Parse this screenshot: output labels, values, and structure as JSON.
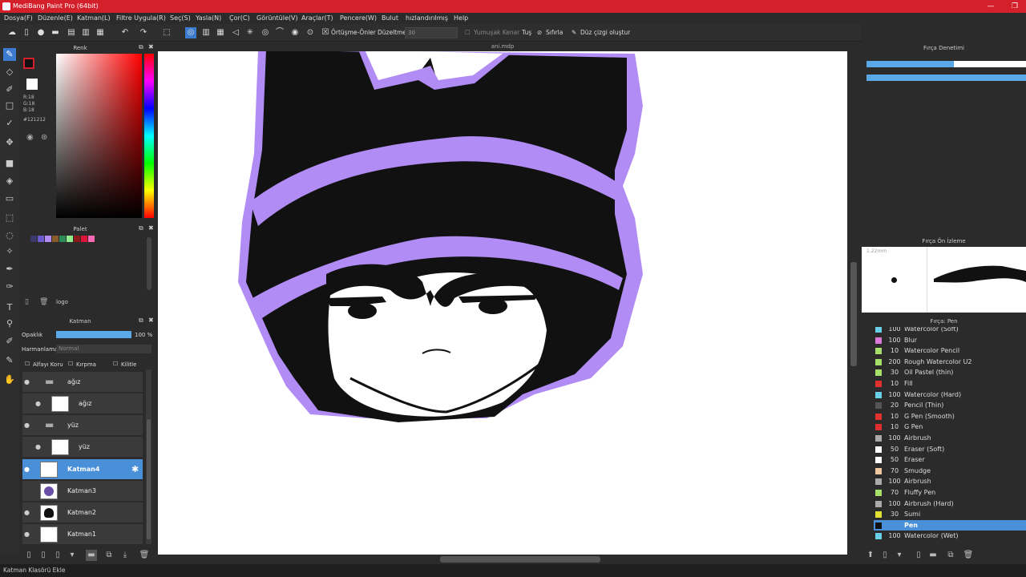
{
  "window": {
    "title": "MediBang Paint Pro (64bit)",
    "minimize": "—",
    "restore": "❐"
  },
  "menu": [
    "Dosya(F)",
    "Düzenle(E)",
    "Katman(L)",
    "Filtre Uygula(R)",
    "Seç(S)",
    "Yasla(N)",
    "Çor(C)",
    "Görüntüle(V)",
    "Araçlar(T)",
    "Pencere(W)",
    "Bulut",
    "hızlandırılmış",
    "Help"
  ],
  "toolbar": {
    "overlap_label": "Örtüşme-Önler",
    "correction_label": "Düzeltme",
    "correction_value": "30",
    "soft_edge_label": "Yumuşak Kenar",
    "tus_label": "Tuş",
    "reset_label": "Sıfırla",
    "straight_line_label": "Düz çizgi oluştur"
  },
  "canvas": {
    "filename": "ani.mdp",
    "hat_color": "#111111",
    "outline_color": "#b18cf5"
  },
  "color_panel": {
    "title": "Renk",
    "r": "R:18",
    "g": "G:18",
    "b": "B:18",
    "hex": "#121212",
    "primary": "#d4202a",
    "secondary": "#ffffff"
  },
  "palette": {
    "title": "Palet",
    "swatches": [
      "#2b2b2b",
      "#3a3a6a",
      "#6a5acd",
      "#b18cf5",
      "#8b5a2b",
      "#2e8b57",
      "#90ee90",
      "#8b1a1a",
      "#dc143c",
      "#ff69b4"
    ],
    "group_name": "logo"
  },
  "layer_panel": {
    "title": "Katman",
    "opacity_label": "Opaklık",
    "opacity_value": "100 %",
    "opacity_fraction": 1.0,
    "blend_label": "Harmanlama",
    "blend_value": "Normal",
    "alpha_lock": "Alfayı Koru",
    "clipping": "Kırpma",
    "lock": "Kilitle",
    "layers": [
      {
        "name": "ağız",
        "kind": "folder"
      },
      {
        "name": "ağız",
        "kind": "layer"
      },
      {
        "name": "yüz",
        "kind": "folder"
      },
      {
        "name": "yüz",
        "kind": "layer"
      },
      {
        "name": "Katman4",
        "kind": "layer",
        "selected": true
      },
      {
        "name": "Katman3",
        "kind": "layer"
      },
      {
        "name": "Katman2",
        "kind": "layer"
      },
      {
        "name": "Katman1",
        "kind": "layer"
      }
    ]
  },
  "brush_control": {
    "title": "Fırça Denetimi"
  },
  "brush_preview": {
    "title": "Fırça Ön İzleme",
    "size": "1.22mm"
  },
  "brush_list": {
    "title": "Fırça: Pen",
    "items": [
      {
        "size": "100",
        "name": "Watercolor (Soft)",
        "color": "#6ad0e8"
      },
      {
        "size": "100",
        "name": "Blur",
        "color": "#e07ad8"
      },
      {
        "size": "10",
        "name": "Watercolor Pencil",
        "color": "#a6e06a"
      },
      {
        "size": "200",
        "name": "Rough Watercolor U2",
        "color": "#a6e06a"
      },
      {
        "size": "30",
        "name": "Oil Pastel (thin)",
        "color": "#a6e06a"
      },
      {
        "size": "10",
        "name": "Fill",
        "color": "#e03030"
      },
      {
        "size": "100",
        "name": "Watercolor (Hard)",
        "color": "#6ad0e8"
      },
      {
        "size": "20",
        "name": "Pencil (Thin)",
        "color": "#555555"
      },
      {
        "size": "10",
        "name": "G Pen (Smooth)",
        "color": "#e03030"
      },
      {
        "size": "10",
        "name": "G Pen",
        "color": "#e03030"
      },
      {
        "size": "100",
        "name": "Airbrush",
        "color": "#aaaaaa"
      },
      {
        "size": "50",
        "name": "Eraser (Soft)",
        "color": "#ffffff"
      },
      {
        "size": "50",
        "name": "Eraser",
        "color": "#ffffff"
      },
      {
        "size": "70",
        "name": "Smudge",
        "color": "#f0c8a0"
      },
      {
        "size": "100",
        "name": "Airbrush",
        "color": "#aaaaaa"
      },
      {
        "size": "70",
        "name": "Fluffy Pen",
        "color": "#a6e06a"
      },
      {
        "size": "100",
        "name": "Airbrush (Hard)",
        "color": "#aaaaaa"
      },
      {
        "size": "30",
        "name": "Sumi",
        "color": "#e0e030"
      },
      {
        "size": "",
        "name": "Pen",
        "color": "#111111",
        "selected": true
      },
      {
        "size": "100",
        "name": "Watercolor (Wet)",
        "color": "#6ad0e8"
      }
    ]
  },
  "status": {
    "text": "Katman Klasörü Ekle"
  }
}
